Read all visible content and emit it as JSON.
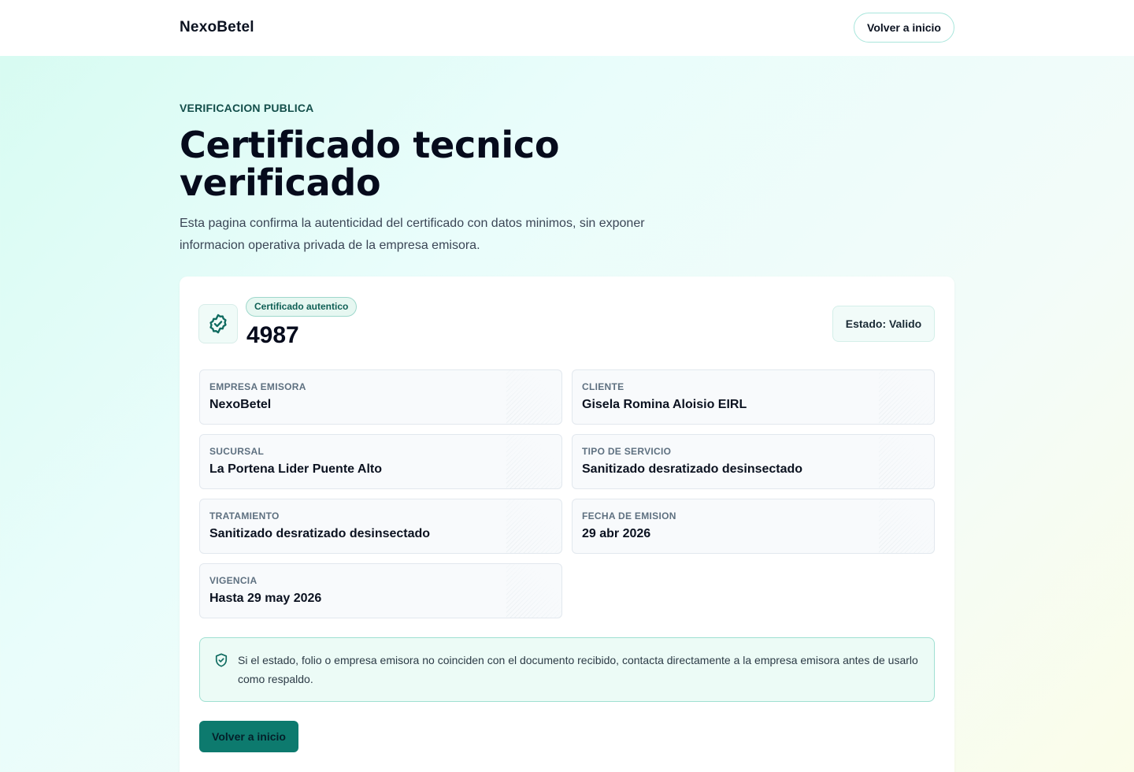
{
  "header": {
    "brand": "NexoBetel",
    "back_label": "Volver a inicio"
  },
  "hero": {
    "eyebrow": "VERIFICACION PUBLICA",
    "title": "Certificado tecnico verificado",
    "description": "Esta pagina confirma la autenticidad del certificado con datos minimos, sin exponer informacion operativa privada de la empresa emisora."
  },
  "certificate": {
    "seal_icon": "badge-check-icon",
    "badge": "Certificado autentico",
    "folio": "4987",
    "status": "Estado: Valido",
    "fields": [
      {
        "label": "EMPRESA EMISORA",
        "value": "NexoBetel"
      },
      {
        "label": "CLIENTE",
        "value": "Gisela Romina Aloisio EIRL"
      },
      {
        "label": "SUCURSAL",
        "value": "La Portena Lider Puente Alto"
      },
      {
        "label": "TIPO DE SERVICIO",
        "value": "Sanitizado desratizado desinsectado"
      },
      {
        "label": "TRATAMIENTO",
        "value": "Sanitizado desratizado desinsectado"
      },
      {
        "label": "FECHA DE EMISION",
        "value": "29 abr 2026"
      },
      {
        "label": "VIGENCIA",
        "value": "Hasta 29 may 2026"
      }
    ],
    "notice": {
      "icon": "shield-check-icon",
      "text": "Si el estado, folio o empresa emisora no coinciden con el documento recibido, contacta directamente a la empresa emisora antes de usarlo como respaldo."
    },
    "cta_label": "Volver a inicio"
  },
  "colors": {
    "accent": "#0d7a6e",
    "badge_bg": "#e6f7f1",
    "notice_bg": "#ecfbf6",
    "notice_border": "#9fe0d2"
  }
}
